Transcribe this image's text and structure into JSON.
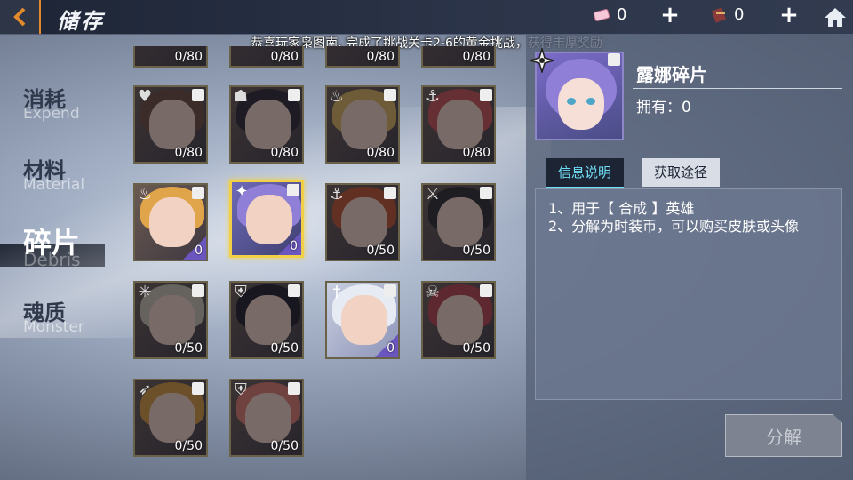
{
  "header": {
    "title": "储存",
    "resource_1": {
      "icon": "ticket-icon",
      "count": "0"
    },
    "resource_2": {
      "icon": "book-icon",
      "count": "0"
    }
  },
  "notice": "恭喜玩家枭图南, 完成了挑战关卡2-6的黄金挑战，获得丰厚奖励",
  "nav": {
    "items": [
      {
        "zh": "消耗",
        "en": "Expend",
        "active": false
      },
      {
        "zh": "材料",
        "en": "Material",
        "active": false
      },
      {
        "zh": "碎片",
        "en": "Debris",
        "active": true
      },
      {
        "zh": "魂质",
        "en": "Monster",
        "active": false
      }
    ]
  },
  "grid": {
    "row0": [
      "0/80",
      "0/80",
      "0/80",
      "0/80"
    ],
    "row1": [
      "0/80",
      "0/80",
      "0/80",
      "0/80"
    ],
    "row2": [
      "0",
      "0",
      "0/50",
      "0/50"
    ],
    "row3": [
      "0/50",
      "0/50",
      "0",
      "0/50"
    ],
    "row4": [
      "0/50",
      "0/50"
    ]
  },
  "detail": {
    "name": "露娜碎片",
    "own_label": "拥有：",
    "own_count": "0",
    "tab_info": "信息说明",
    "tab_source": "获取途径",
    "desc_1": "1、用于【 合成 】英雄",
    "desc_2": "2、分解为时装币，可以购买皮肤或头像",
    "decompose_label": "分解"
  },
  "colors": {
    "accent": "#e38a2c",
    "selected": "#f1d048",
    "tab_active": "#6fe0f6",
    "corner": "#6b56c0"
  }
}
